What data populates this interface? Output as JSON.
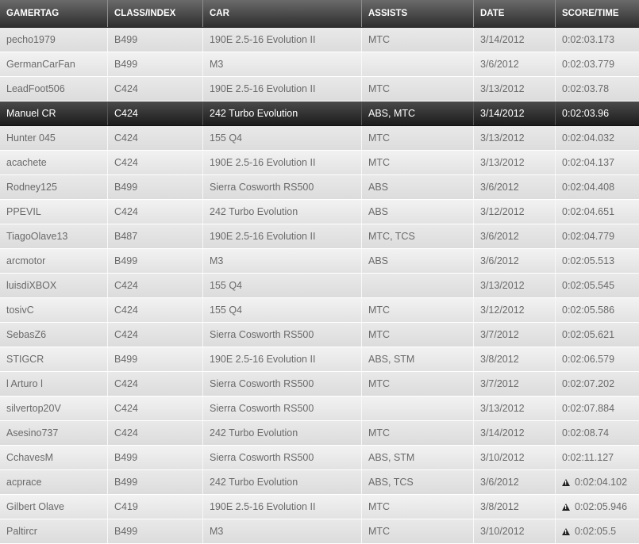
{
  "columns": [
    "GAMERTAG",
    "CLASS/INDEX",
    "CAR",
    "ASSISTS",
    "DATE",
    "SCORE/TIME"
  ],
  "rows": [
    {
      "gamertag": "pecho1979",
      "class": "B499",
      "car": "190E 2.5-16 Evolution II",
      "assists": "MTC",
      "date": "3/14/2012",
      "time": "0:02:03.173",
      "warning": false,
      "selected": false
    },
    {
      "gamertag": "GermanCarFan",
      "class": "B499",
      "car": "M3",
      "assists": "",
      "date": "3/6/2012",
      "time": "0:02:03.779",
      "warning": false,
      "selected": false
    },
    {
      "gamertag": "LeadFoot506",
      "class": "C424",
      "car": "190E 2.5-16 Evolution II",
      "assists": "MTC",
      "date": "3/13/2012",
      "time": "0:02:03.78",
      "warning": false,
      "selected": false
    },
    {
      "gamertag": "Manuel CR",
      "class": "C424",
      "car": "242 Turbo Evolution",
      "assists": "ABS, MTC",
      "date": "3/14/2012",
      "time": "0:02:03.96",
      "warning": false,
      "selected": true
    },
    {
      "gamertag": "Hunter 045",
      "class": "C424",
      "car": "155 Q4",
      "assists": "MTC",
      "date": "3/13/2012",
      "time": "0:02:04.032",
      "warning": false,
      "selected": false
    },
    {
      "gamertag": "acachete",
      "class": "C424",
      "car": "190E 2.5-16 Evolution II",
      "assists": "MTC",
      "date": "3/13/2012",
      "time": "0:02:04.137",
      "warning": false,
      "selected": false
    },
    {
      "gamertag": "Rodney125",
      "class": "B499",
      "car": "Sierra Cosworth RS500",
      "assists": "ABS",
      "date": "3/6/2012",
      "time": "0:02:04.408",
      "warning": false,
      "selected": false
    },
    {
      "gamertag": "PPEVIL",
      "class": "C424",
      "car": "242 Turbo Evolution",
      "assists": "ABS",
      "date": "3/12/2012",
      "time": "0:02:04.651",
      "warning": false,
      "selected": false
    },
    {
      "gamertag": "TiagoOlave13",
      "class": "B487",
      "car": "190E 2.5-16 Evolution II",
      "assists": "MTC, TCS",
      "date": "3/6/2012",
      "time": "0:02:04.779",
      "warning": false,
      "selected": false
    },
    {
      "gamertag": "arcmotor",
      "class": "B499",
      "car": "M3",
      "assists": "ABS",
      "date": "3/6/2012",
      "time": "0:02:05.513",
      "warning": false,
      "selected": false
    },
    {
      "gamertag": "luisdiXBOX",
      "class": "C424",
      "car": "155 Q4",
      "assists": "",
      "date": "3/13/2012",
      "time": "0:02:05.545",
      "warning": false,
      "selected": false
    },
    {
      "gamertag": "tosivC",
      "class": "C424",
      "car": "155 Q4",
      "assists": "MTC",
      "date": "3/12/2012",
      "time": "0:02:05.586",
      "warning": false,
      "selected": false
    },
    {
      "gamertag": "SebasZ6",
      "class": "C424",
      "car": "Sierra Cosworth RS500",
      "assists": "MTC",
      "date": "3/7/2012",
      "time": "0:02:05.621",
      "warning": false,
      "selected": false
    },
    {
      "gamertag": "STIGCR",
      "class": "B499",
      "car": "190E 2.5-16 Evolution II",
      "assists": "ABS, STM",
      "date": "3/8/2012",
      "time": "0:02:06.579",
      "warning": false,
      "selected": false
    },
    {
      "gamertag": "l Arturo l",
      "class": "C424",
      "car": "Sierra Cosworth RS500",
      "assists": "MTC",
      "date": "3/7/2012",
      "time": "0:02:07.202",
      "warning": false,
      "selected": false
    },
    {
      "gamertag": "silvertop20V",
      "class": "C424",
      "car": "Sierra Cosworth RS500",
      "assists": "",
      "date": "3/13/2012",
      "time": "0:02:07.884",
      "warning": false,
      "selected": false
    },
    {
      "gamertag": "Asesino737",
      "class": "C424",
      "car": "242 Turbo Evolution",
      "assists": "MTC",
      "date": "3/14/2012",
      "time": "0:02:08.74",
      "warning": false,
      "selected": false
    },
    {
      "gamertag": "CchavesM",
      "class": "B499",
      "car": "Sierra Cosworth RS500",
      "assists": "ABS, STM",
      "date": "3/10/2012",
      "time": "0:02:11.127",
      "warning": false,
      "selected": false
    },
    {
      "gamertag": "acprace",
      "class": "B499",
      "car": "242 Turbo Evolution",
      "assists": "ABS, TCS",
      "date": "3/6/2012",
      "time": "0:02:04.102",
      "warning": true,
      "selected": false
    },
    {
      "gamertag": "Gilbert Olave",
      "class": "C419",
      "car": "190E 2.5-16 Evolution II",
      "assists": "MTC",
      "date": "3/8/2012",
      "time": "0:02:05.946",
      "warning": true,
      "selected": false
    },
    {
      "gamertag": "Paltircr",
      "class": "B499",
      "car": "M3",
      "assists": "MTC",
      "date": "3/10/2012",
      "time": "0:02:05.5",
      "warning": true,
      "selected": false
    }
  ],
  "icons": {
    "warning": "warning-icon"
  },
  "colors": {
    "header_bg": "#3a3a3a",
    "selected_bg": "#2a2a2a",
    "row_bg": "#e4e4e4",
    "text": "#6a6a6a"
  }
}
